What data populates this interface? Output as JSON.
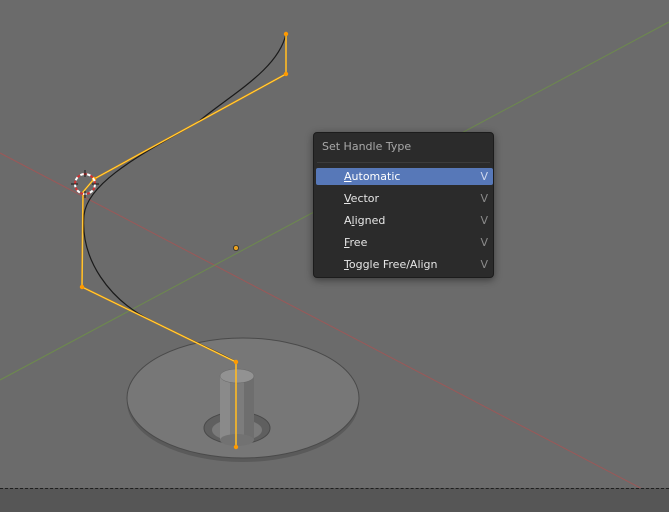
{
  "menu": {
    "title": "Set Handle Type",
    "items": [
      {
        "mnemonic": "A",
        "rest": "utomatic",
        "key": "V",
        "active": true
      },
      {
        "mnemonic": "V",
        "rest": "ector",
        "key": "V",
        "active": false
      },
      {
        "pre": "A",
        "mnemonic": "l",
        "rest": "igned",
        "key": "V",
        "active": false
      },
      {
        "mnemonic": "F",
        "rest": "ree",
        "key": "V",
        "active": false
      },
      {
        "mnemonic": "T",
        "rest": "oggle Free/Align",
        "key": "V",
        "active": false
      }
    ]
  },
  "colors": {
    "viewport_bg": "#6b6b6b",
    "x_axis": "#a45a5a",
    "y_axis": "#6e8a4c",
    "selection": "#ffa500",
    "menu_bg": "#2b2b2b",
    "menu_highlight": "#5778b8"
  }
}
